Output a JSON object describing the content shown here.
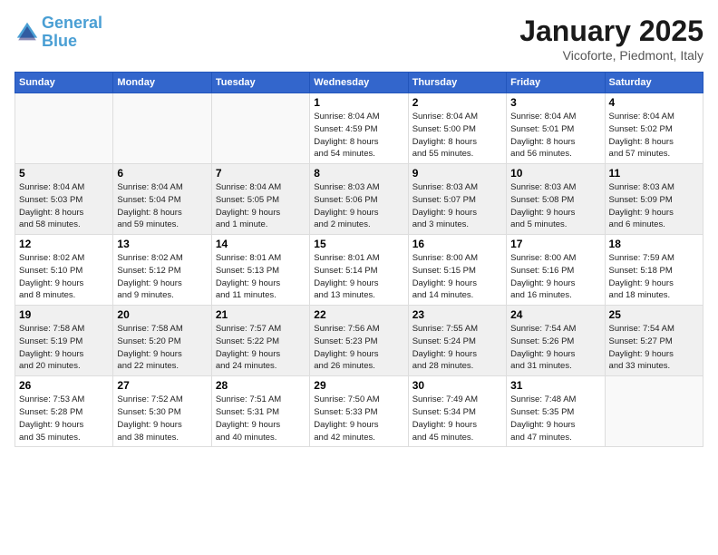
{
  "logo": {
    "line1": "General",
    "line2": "Blue"
  },
  "title": "January 2025",
  "subtitle": "Vicoforte, Piedmont, Italy",
  "headers": [
    "Sunday",
    "Monday",
    "Tuesday",
    "Wednesday",
    "Thursday",
    "Friday",
    "Saturday"
  ],
  "weeks": [
    {
      "shaded": false,
      "days": [
        {
          "num": "",
          "info": ""
        },
        {
          "num": "",
          "info": ""
        },
        {
          "num": "",
          "info": ""
        },
        {
          "num": "1",
          "info": "Sunrise: 8:04 AM\nSunset: 4:59 PM\nDaylight: 8 hours\nand 54 minutes."
        },
        {
          "num": "2",
          "info": "Sunrise: 8:04 AM\nSunset: 5:00 PM\nDaylight: 8 hours\nand 55 minutes."
        },
        {
          "num": "3",
          "info": "Sunrise: 8:04 AM\nSunset: 5:01 PM\nDaylight: 8 hours\nand 56 minutes."
        },
        {
          "num": "4",
          "info": "Sunrise: 8:04 AM\nSunset: 5:02 PM\nDaylight: 8 hours\nand 57 minutes."
        }
      ]
    },
    {
      "shaded": true,
      "days": [
        {
          "num": "5",
          "info": "Sunrise: 8:04 AM\nSunset: 5:03 PM\nDaylight: 8 hours\nand 58 minutes."
        },
        {
          "num": "6",
          "info": "Sunrise: 8:04 AM\nSunset: 5:04 PM\nDaylight: 8 hours\nand 59 minutes."
        },
        {
          "num": "7",
          "info": "Sunrise: 8:04 AM\nSunset: 5:05 PM\nDaylight: 9 hours\nand 1 minute."
        },
        {
          "num": "8",
          "info": "Sunrise: 8:03 AM\nSunset: 5:06 PM\nDaylight: 9 hours\nand 2 minutes."
        },
        {
          "num": "9",
          "info": "Sunrise: 8:03 AM\nSunset: 5:07 PM\nDaylight: 9 hours\nand 3 minutes."
        },
        {
          "num": "10",
          "info": "Sunrise: 8:03 AM\nSunset: 5:08 PM\nDaylight: 9 hours\nand 5 minutes."
        },
        {
          "num": "11",
          "info": "Sunrise: 8:03 AM\nSunset: 5:09 PM\nDaylight: 9 hours\nand 6 minutes."
        }
      ]
    },
    {
      "shaded": false,
      "days": [
        {
          "num": "12",
          "info": "Sunrise: 8:02 AM\nSunset: 5:10 PM\nDaylight: 9 hours\nand 8 minutes."
        },
        {
          "num": "13",
          "info": "Sunrise: 8:02 AM\nSunset: 5:12 PM\nDaylight: 9 hours\nand 9 minutes."
        },
        {
          "num": "14",
          "info": "Sunrise: 8:01 AM\nSunset: 5:13 PM\nDaylight: 9 hours\nand 11 minutes."
        },
        {
          "num": "15",
          "info": "Sunrise: 8:01 AM\nSunset: 5:14 PM\nDaylight: 9 hours\nand 13 minutes."
        },
        {
          "num": "16",
          "info": "Sunrise: 8:00 AM\nSunset: 5:15 PM\nDaylight: 9 hours\nand 14 minutes."
        },
        {
          "num": "17",
          "info": "Sunrise: 8:00 AM\nSunset: 5:16 PM\nDaylight: 9 hours\nand 16 minutes."
        },
        {
          "num": "18",
          "info": "Sunrise: 7:59 AM\nSunset: 5:18 PM\nDaylight: 9 hours\nand 18 minutes."
        }
      ]
    },
    {
      "shaded": true,
      "days": [
        {
          "num": "19",
          "info": "Sunrise: 7:58 AM\nSunset: 5:19 PM\nDaylight: 9 hours\nand 20 minutes."
        },
        {
          "num": "20",
          "info": "Sunrise: 7:58 AM\nSunset: 5:20 PM\nDaylight: 9 hours\nand 22 minutes."
        },
        {
          "num": "21",
          "info": "Sunrise: 7:57 AM\nSunset: 5:22 PM\nDaylight: 9 hours\nand 24 minutes."
        },
        {
          "num": "22",
          "info": "Sunrise: 7:56 AM\nSunset: 5:23 PM\nDaylight: 9 hours\nand 26 minutes."
        },
        {
          "num": "23",
          "info": "Sunrise: 7:55 AM\nSunset: 5:24 PM\nDaylight: 9 hours\nand 28 minutes."
        },
        {
          "num": "24",
          "info": "Sunrise: 7:54 AM\nSunset: 5:26 PM\nDaylight: 9 hours\nand 31 minutes."
        },
        {
          "num": "25",
          "info": "Sunrise: 7:54 AM\nSunset: 5:27 PM\nDaylight: 9 hours\nand 33 minutes."
        }
      ]
    },
    {
      "shaded": false,
      "days": [
        {
          "num": "26",
          "info": "Sunrise: 7:53 AM\nSunset: 5:28 PM\nDaylight: 9 hours\nand 35 minutes."
        },
        {
          "num": "27",
          "info": "Sunrise: 7:52 AM\nSunset: 5:30 PM\nDaylight: 9 hours\nand 38 minutes."
        },
        {
          "num": "28",
          "info": "Sunrise: 7:51 AM\nSunset: 5:31 PM\nDaylight: 9 hours\nand 40 minutes."
        },
        {
          "num": "29",
          "info": "Sunrise: 7:50 AM\nSunset: 5:33 PM\nDaylight: 9 hours\nand 42 minutes."
        },
        {
          "num": "30",
          "info": "Sunrise: 7:49 AM\nSunset: 5:34 PM\nDaylight: 9 hours\nand 45 minutes."
        },
        {
          "num": "31",
          "info": "Sunrise: 7:48 AM\nSunset: 5:35 PM\nDaylight: 9 hours\nand 47 minutes."
        },
        {
          "num": "",
          "info": ""
        }
      ]
    }
  ]
}
